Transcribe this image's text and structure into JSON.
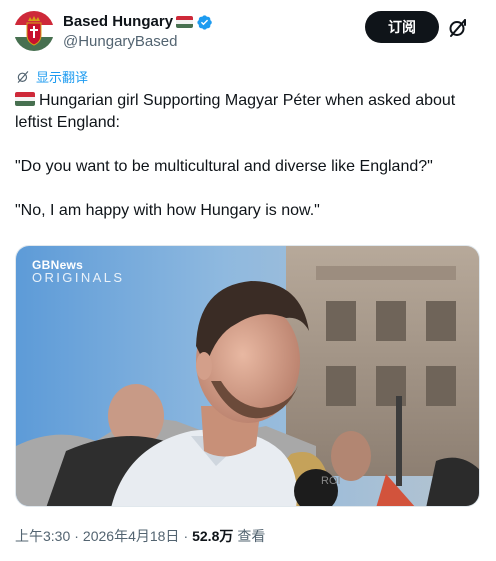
{
  "author": {
    "display_name": "Based Hungary",
    "handle": "@HungaryBased",
    "verified": true,
    "flag_colors": [
      "#ce2939",
      "#ffffff",
      "#477050"
    ]
  },
  "actions": {
    "subscribe_label": "订阅",
    "grok_icon": "grok-icon"
  },
  "translate_label": "显示翻译",
  "tweet": {
    "line1": "Hungarian girl Supporting Magyar Péter when asked about leftist England:",
    "line2": "\"Do you want to be multicultural and diverse like England?\"",
    "line3": "\"No, I am happy with how Hungary is now.\""
  },
  "media": {
    "brand": "GBNews",
    "brand_sub": "ORIGINALS"
  },
  "meta": {
    "time": "上午3:30",
    "sep1": "·",
    "date": "2026年4月18日",
    "sep2": "·",
    "views": "52.8万",
    "views_label": "查看"
  },
  "colors": {
    "accent": "#1d9bf0",
    "text": "#0f1419",
    "muted": "#536471"
  }
}
